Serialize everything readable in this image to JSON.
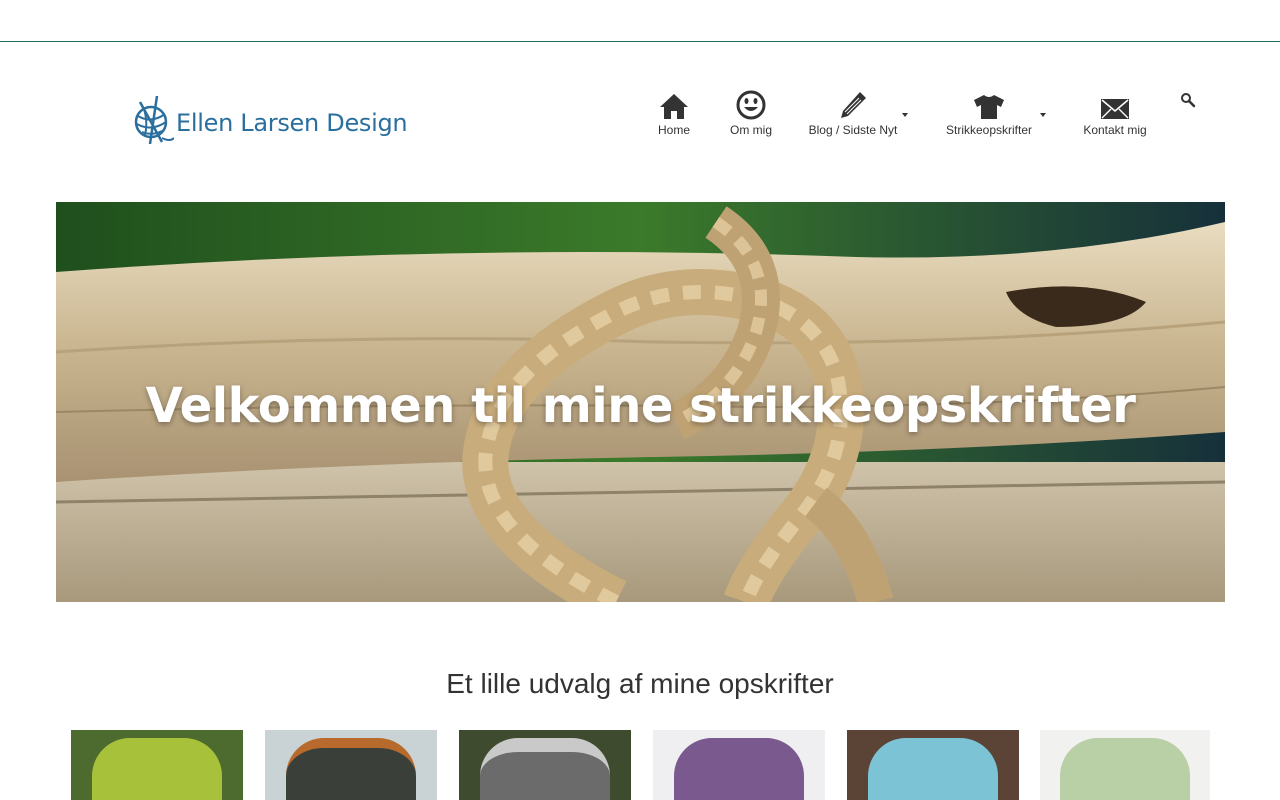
{
  "site": {
    "logo_text": "Ellen Larsen Design",
    "brand_color": "#2b6f9e",
    "header_line_color": "#1f6b67"
  },
  "nav": {
    "items": [
      {
        "label": "Home",
        "icon": "home-icon",
        "has_dropdown": false
      },
      {
        "label": "Om mig",
        "icon": "smiley-icon",
        "has_dropdown": false
      },
      {
        "label": "Blog / Sidste Nyt",
        "icon": "pencil-icon",
        "has_dropdown": true
      },
      {
        "label": "Strikkeopskrifter",
        "icon": "tshirt-icon",
        "has_dropdown": true
      },
      {
        "label": "Kontakt mig",
        "icon": "envelope-icon",
        "has_dropdown": false
      }
    ],
    "search_icon": "search-icon"
  },
  "hero": {
    "title": "Velkommen til mine strikkeopskrifter"
  },
  "featured": {
    "title": "Et lille udvalg af mine opskrifter",
    "thumbnails": [
      {
        "name": "green-sweater",
        "color": "#a7c23a"
      },
      {
        "name": "dark-yoke-sweater",
        "color": "#3a3f3a"
      },
      {
        "name": "grey-sweater",
        "color": "#6b6b6b"
      },
      {
        "name": "purple-top",
        "color": "#7a5a8e"
      },
      {
        "name": "blue-top",
        "color": "#7cc3d6"
      },
      {
        "name": "mint-sweater",
        "color": "#b9cfa6"
      }
    ]
  }
}
